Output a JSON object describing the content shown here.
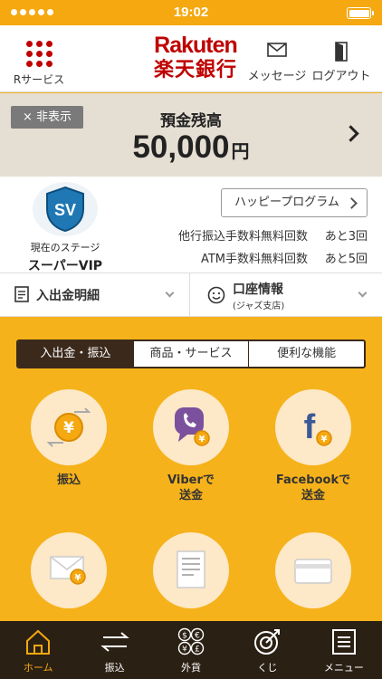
{
  "status_bar": {
    "time": "19:02"
  },
  "header": {
    "rservice_label": "Rサービス",
    "logo_en": "Rakuten",
    "logo_ja": "楽天銀行",
    "message_label": "メッセージ",
    "logout_label": "ログアウト"
  },
  "balance": {
    "hide_label": "× 非表示",
    "label": "預金残高",
    "amount": "50,000",
    "unit": "円"
  },
  "stage": {
    "badge": "SV",
    "current_label": "現在のステージ",
    "name": "スーパーVIP",
    "happy_program": "ハッピープログラム",
    "fees": [
      {
        "label": "他行振込手数料無料回数",
        "count": "あと3回"
      },
      {
        "label": "ATM手数料無料回数",
        "count": "あと5回"
      }
    ]
  },
  "actions": {
    "statement": "入出金明細",
    "account_title": "口座情報",
    "account_sub": "(ジャズ支店)"
  },
  "tabs": [
    "入出金・振込",
    "商品・サービス",
    "便利な機能"
  ],
  "tiles": [
    {
      "label": "振込",
      "icon": "yen-coin-transfer-icon"
    },
    {
      "label": "Viberで\n送金",
      "icon": "viber-icon"
    },
    {
      "label": "Facebookで\n送金",
      "icon": "facebook-icon"
    },
    {
      "label": "",
      "icon": "envelope-yen-icon"
    },
    {
      "label": "",
      "icon": "document-icon"
    },
    {
      "label": "",
      "icon": "card-icon"
    }
  ],
  "nav": [
    {
      "label": "ホーム",
      "icon": "home-icon"
    },
    {
      "label": "振込",
      "icon": "transfer-icon"
    },
    {
      "label": "外貨",
      "icon": "currency-icon"
    },
    {
      "label": "くじ",
      "icon": "target-icon"
    },
    {
      "label": "メニュー",
      "icon": "menu-icon"
    }
  ],
  "colors": {
    "accent": "#f5a80f",
    "brand": "#bf0000",
    "nav_bg": "#2b2014"
  }
}
